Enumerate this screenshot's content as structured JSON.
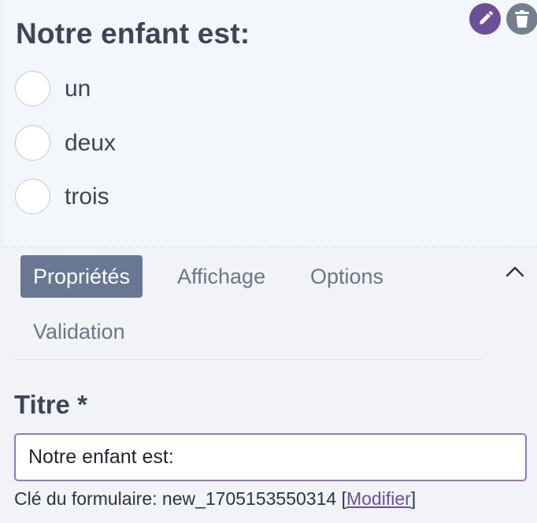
{
  "field": {
    "title": "Notre enfant est:",
    "options": [
      "un",
      "deux",
      "trois"
    ],
    "edit_icon": "pencil-icon",
    "delete_icon": "trash-icon"
  },
  "panel": {
    "tabs": [
      "Propriétés",
      "Affichage",
      "Options",
      "Validation"
    ],
    "active_tab": "Propriétés",
    "collapse_icon": "chevron-up-icon",
    "title_label": "Titre *",
    "title_value": "Notre enfant est:",
    "form_key_prefix": "Clé du formulaire: new_1705153550314 [",
    "form_key_link": "Modifier",
    "form_key_suffix": "]"
  },
  "colors": {
    "accent": "#6b4f97",
    "active_tab_bg": "#687892",
    "input_border": "#8f7bb8",
    "delete_button": "#74808f"
  }
}
